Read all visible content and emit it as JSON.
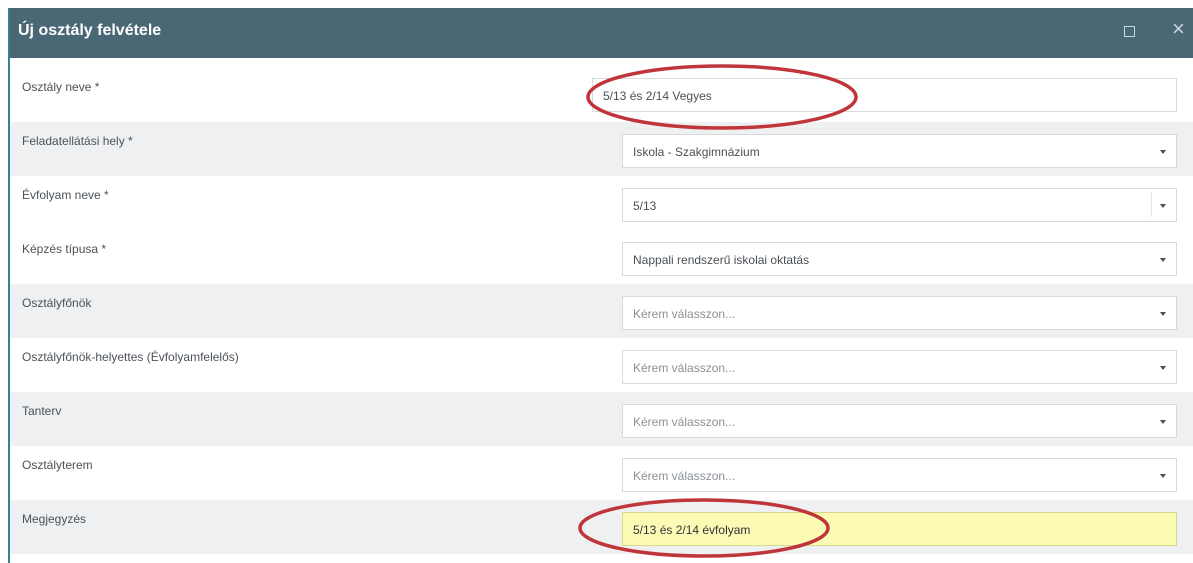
{
  "dialog": {
    "title": "Új osztály felvétele",
    "maximize_icon": "maximize-icon",
    "close_icon": "close-icon",
    "close_glyph": "×"
  },
  "form": {
    "rows": [
      {
        "label": "Osztály neve *",
        "value": "5/13 és 2/14 Vegyes",
        "type": "text"
      },
      {
        "label": "Feladatellátási hely *",
        "value": "Iskola - Szakgimnázium",
        "type": "select"
      },
      {
        "label": "Évfolyam neve *",
        "value": "5/13",
        "type": "select"
      },
      {
        "label": "Képzés típusa *",
        "value": "Nappali rendszerű iskolai oktatás",
        "type": "select"
      },
      {
        "label": "Osztályfőnök",
        "placeholder": "Kérem válasszon...",
        "type": "select"
      },
      {
        "label": "Osztályfőnök-helyettes (Évfolyamfelelős)",
        "placeholder": "Kérem válasszon...",
        "type": "select"
      },
      {
        "label": "Tanterv",
        "placeholder": "Kérem válasszon...",
        "type": "select"
      },
      {
        "label": "Osztályterem",
        "placeholder": "Kérem válasszon...",
        "type": "select"
      },
      {
        "label": "Megjegyzés",
        "value": "5/13 és 2/14 évfolyam",
        "type": "text"
      }
    ]
  },
  "colors": {
    "titlebar": "#4a6776",
    "annotation_circle": "#c0353a",
    "highlight_field": "#fbfbb5"
  }
}
